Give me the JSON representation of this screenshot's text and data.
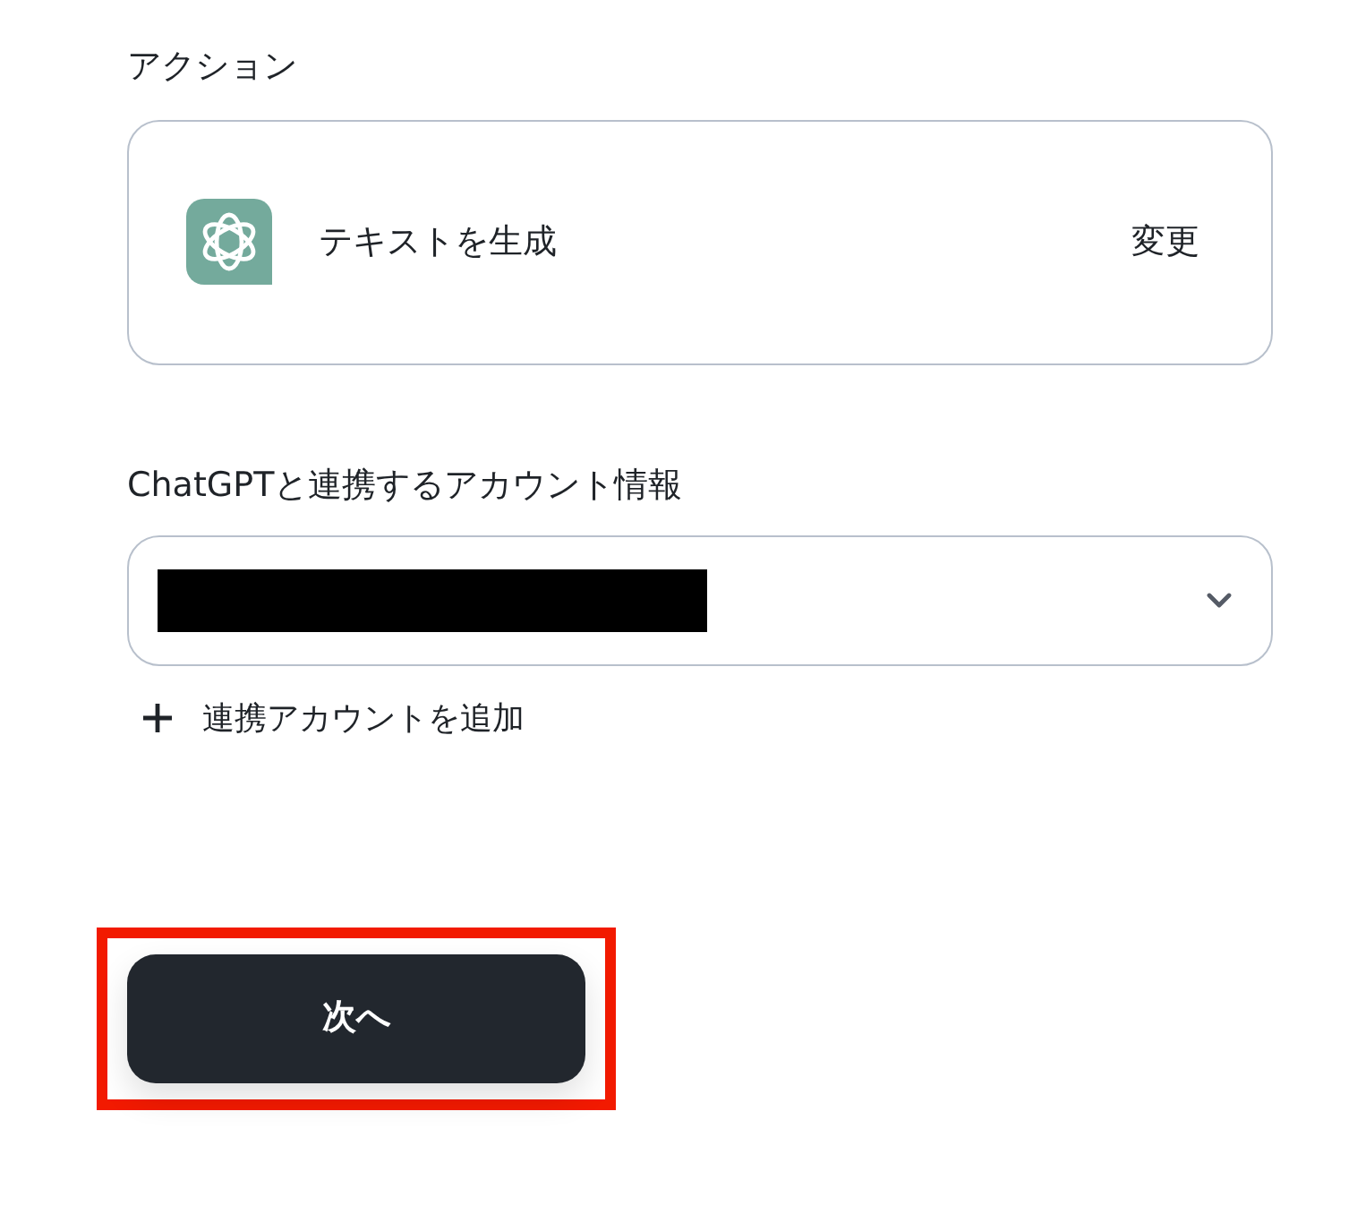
{
  "action_section": {
    "heading": "アクション",
    "action": {
      "label": "テキストを生成",
      "change_link": "変更"
    }
  },
  "account_section": {
    "heading": "ChatGPTと連携するアカウント情報",
    "select": {
      "value_redacted": true
    },
    "add_link": "連携アカウントを追加"
  },
  "next_button": {
    "label": "次へ",
    "highlighted": true
  }
}
